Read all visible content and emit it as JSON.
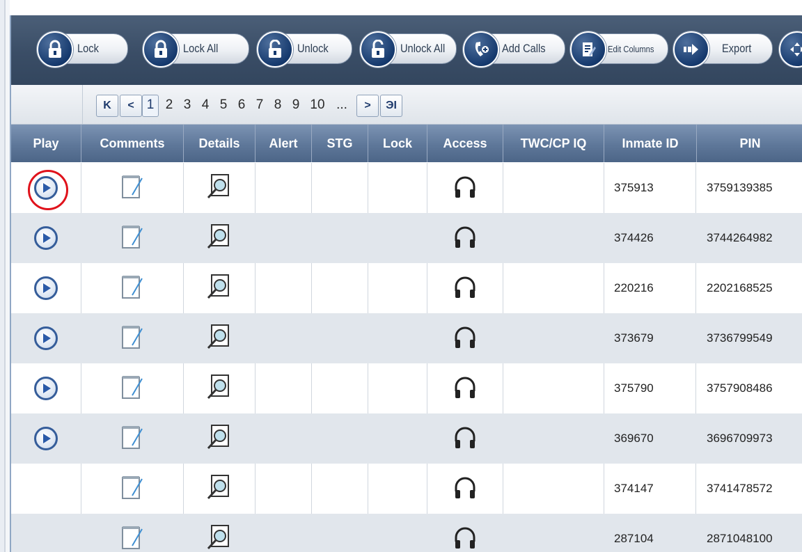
{
  "toolbar": {
    "buttons": [
      {
        "label": "Lock",
        "icon": "lock-icon"
      },
      {
        "label": "Lock All",
        "icon": "lock-all-icon"
      },
      {
        "label": "Unlock",
        "icon": "unlock-icon"
      },
      {
        "label": "Unlock All",
        "icon": "unlock-all-icon"
      },
      {
        "label": "Add Calls",
        "icon": "add-calls-icon"
      },
      {
        "label": "Edit Columns",
        "icon": "edit-columns-icon"
      },
      {
        "label": "Export",
        "icon": "export-icon"
      }
    ]
  },
  "pager": {
    "first_glyph": "K",
    "prev_glyph": "<",
    "next_glyph": ">",
    "last_glyph": "ЭI",
    "current": "1",
    "pages": [
      "2",
      "3",
      "4",
      "5",
      "6",
      "7",
      "8",
      "9",
      "10"
    ],
    "ellipsis": "..."
  },
  "table": {
    "columns": [
      "Play",
      "Comments",
      "Details",
      "Alert",
      "STG",
      "Lock",
      "Access",
      "TWC/CP IQ",
      "Inmate ID",
      "PIN"
    ],
    "rows": [
      {
        "has_play": true,
        "highlighted": true,
        "inmate_id": "375913",
        "pin": "3759139385"
      },
      {
        "has_play": true,
        "highlighted": false,
        "inmate_id": "374426",
        "pin": "3744264982"
      },
      {
        "has_play": true,
        "highlighted": false,
        "inmate_id": "220216",
        "pin": "2202168525"
      },
      {
        "has_play": true,
        "highlighted": false,
        "inmate_id": "373679",
        "pin": "3736799549"
      },
      {
        "has_play": true,
        "highlighted": false,
        "inmate_id": "375790",
        "pin": "3757908486"
      },
      {
        "has_play": true,
        "highlighted": false,
        "inmate_id": "369670",
        "pin": "3696709973"
      },
      {
        "has_play": false,
        "highlighted": false,
        "inmate_id": "374147",
        "pin": "3741478572"
      },
      {
        "has_play": false,
        "highlighted": false,
        "inmate_id": "287104",
        "pin": "2871048100"
      }
    ]
  },
  "colors": {
    "toolbar_bg": "#3a4d66",
    "header_bg": "#5e7799",
    "alt_row": "#e1e6ec",
    "highlight": "#e0121b",
    "play_blue": "#2a5aa8"
  }
}
